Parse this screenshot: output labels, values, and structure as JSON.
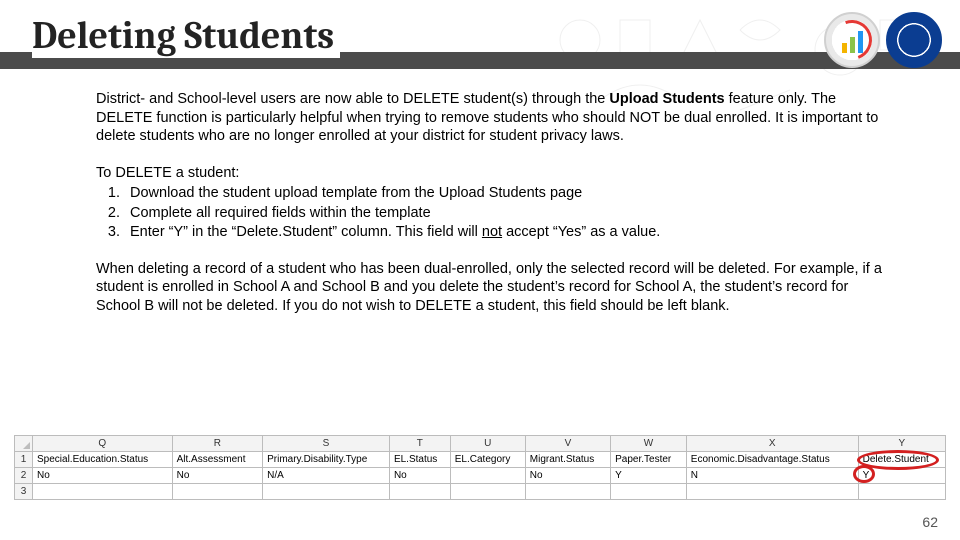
{
  "title": "Deleting Students",
  "intro_html": "District- and School-level users are now able to DELETE student(s) through the <b>Upload Students</b> feature only. The DELETE function is particularly helpful when trying to remove students who should NOT be dual enrolled. It is important to delete students who are no longer enrolled at your district for student privacy laws.",
  "steps_intro": "To DELETE a student:",
  "steps": [
    "Download the student upload template from the Upload Students page",
    "Complete all required fields within the template",
    "Enter “Y” in the “Delete.Student” column. This field will <span class=\"u\">not</span> accept “Yes” as a value."
  ],
  "note": "When deleting a record of a student who has been dual-enrolled, only the selected record will be deleted. For example, if a student is enrolled in School A and School B and you delete the student’s record for School A, the student’s record for School B will not be deleted. If you do not wish to DELETE a student, this field should be left blank.",
  "sheet": {
    "col_letters": [
      "Q",
      "R",
      "S",
      "T",
      "U",
      "V",
      "W",
      "X",
      "Y"
    ],
    "row_numbers": [
      "1",
      "2",
      "3"
    ],
    "field_names": [
      "Special.Education.Status",
      "Alt.Assessment",
      "Primary.Disability.Type",
      "EL.Status",
      "EL.Category",
      "Migrant.Status",
      "Paper.Tester",
      "Economic.Disadvantage.Status",
      "Delete.Student"
    ],
    "data_row": [
      "No",
      "No",
      "N/A",
      "No",
      "",
      "No",
      "Y",
      "N",
      "Y"
    ],
    "circled_field_index": 8,
    "circled_value_index": 8
  },
  "page_number": "62",
  "logos": {
    "assessment": "assessment-program-logo",
    "seal": "idaho-dept-education-seal"
  }
}
